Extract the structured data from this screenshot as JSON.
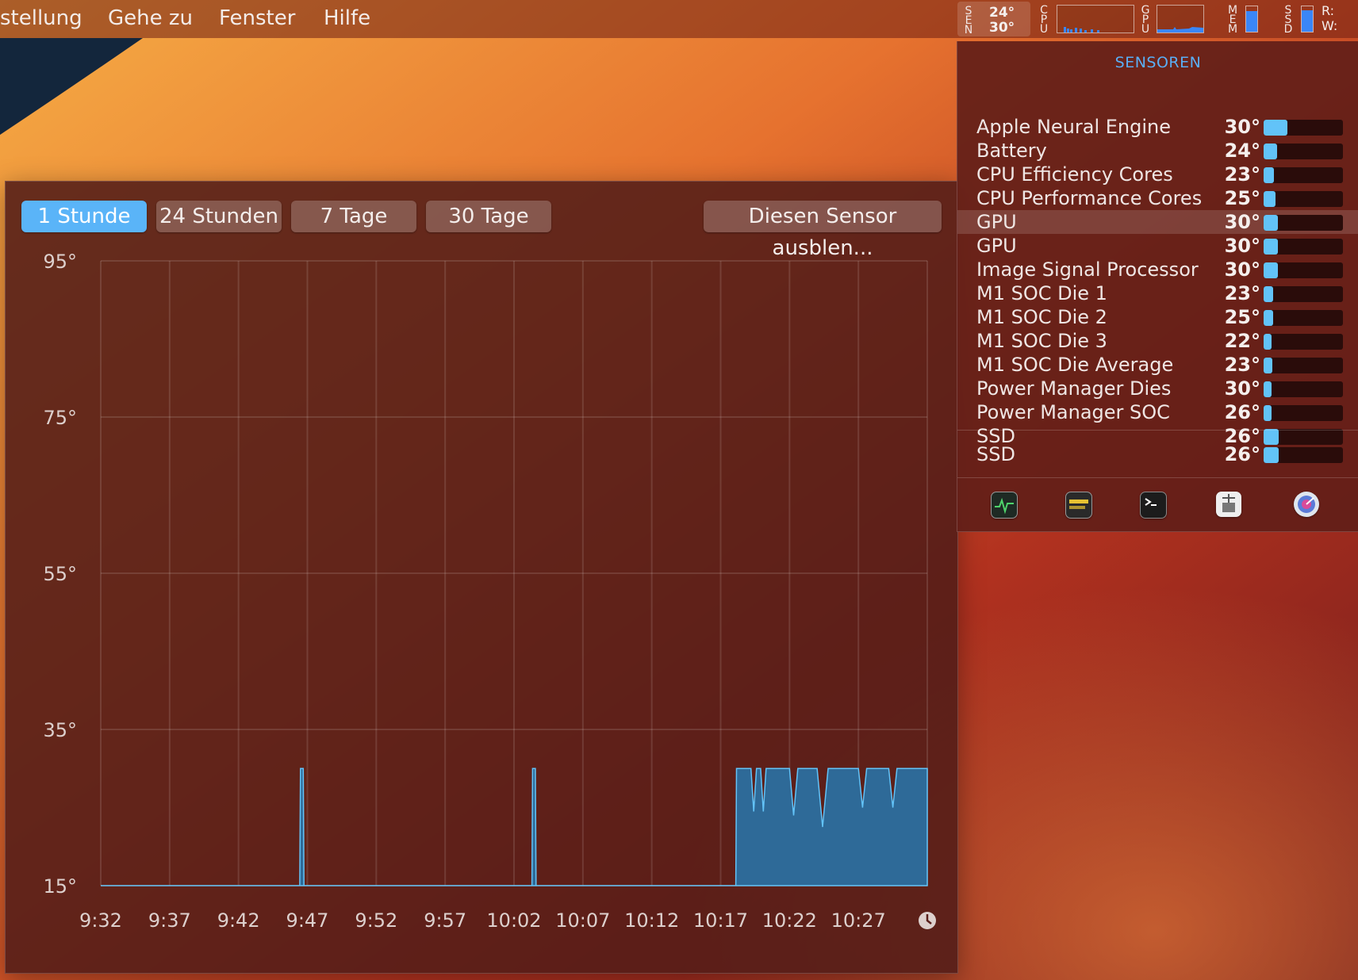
{
  "menubar": {
    "items": [
      "stellung",
      "Gehe zu",
      "Fenster",
      "Hilfe"
    ],
    "sen_label": "SEN",
    "sen_top": "24°",
    "sen_bottom": "30°",
    "cpu_label": "CPU",
    "gpu_label": "GPU",
    "mem_label": "MEM",
    "ssd_label": "SSD",
    "rw_read": "R:",
    "rw_write": "W:",
    "mem_level": 0.8,
    "ssd_level": 0.85
  },
  "history": {
    "tabs": [
      "1 Stunde",
      "24 Stunden",
      "7 Tage",
      "30 Tage"
    ],
    "active_tab": 0,
    "hide_button": "Diesen Sensor ausblen...",
    "clock_icon": "clock-icon"
  },
  "chart_data": {
    "type": "area",
    "x_ticks": [
      "9:32",
      "9:37",
      "9:42",
      "9:47",
      "9:52",
      "9:57",
      "10:02",
      "10:07",
      "10:12",
      "10:17",
      "10:22",
      "10:27"
    ],
    "y_ticks": [
      "95°",
      "75°",
      "55°",
      "35°",
      "15°"
    ],
    "ylim": [
      15,
      95
    ],
    "xlim_minutes": [
      0,
      60
    ],
    "grid": true,
    "color": "#2e6a98",
    "line_color": "#62c3f8",
    "series": [
      {
        "points": [
          [
            0,
            15
          ],
          [
            14.45,
            15
          ],
          [
            14.5,
            30
          ],
          [
            14.7,
            30
          ],
          [
            14.75,
            15
          ],
          [
            31.3,
            15
          ],
          [
            31.35,
            30
          ],
          [
            31.55,
            30
          ],
          [
            31.6,
            15
          ],
          [
            46.1,
            15
          ],
          [
            46.15,
            30
          ],
          [
            47.2,
            30
          ],
          [
            47.4,
            24.5
          ],
          [
            47.6,
            30
          ],
          [
            47.9,
            30
          ],
          [
            48.1,
            24.5
          ],
          [
            48.3,
            30
          ],
          [
            50.0,
            30
          ],
          [
            50.3,
            24
          ],
          [
            50.6,
            30
          ],
          [
            52.0,
            30
          ],
          [
            52.4,
            22.5
          ],
          [
            52.8,
            30
          ],
          [
            55.0,
            30
          ],
          [
            55.3,
            25
          ],
          [
            55.6,
            30
          ],
          [
            57.2,
            30
          ],
          [
            57.5,
            25
          ],
          [
            57.8,
            30
          ],
          [
            60,
            30
          ],
          [
            60,
            15
          ]
        ]
      }
    ]
  },
  "sensors": {
    "heading": "SENSOREN",
    "rows": [
      {
        "name": "Apple Neural Engine",
        "temp": "30°",
        "level": 0.3
      },
      {
        "name": "Battery",
        "temp": "24°",
        "level": 0.17
      },
      {
        "name": "CPU Efficiency Cores",
        "temp": "23°",
        "level": 0.13
      },
      {
        "name": "CPU Performance Cores",
        "temp": "25°",
        "level": 0.15
      },
      {
        "name": "GPU",
        "temp": "30°",
        "level": 0.18
      },
      {
        "name": "GPU",
        "temp": "30°",
        "level": 0.18
      },
      {
        "name": "Image Signal Processor",
        "temp": "30°",
        "level": 0.18
      },
      {
        "name": "M1 SOC Die 1",
        "temp": "23°",
        "level": 0.12
      },
      {
        "name": "M1 SOC Die 2",
        "temp": "25°",
        "level": 0.12
      },
      {
        "name": "M1 SOC Die 3",
        "temp": "22°",
        "level": 0.1
      },
      {
        "name": "M1 SOC Die Average",
        "temp": "23°",
        "level": 0.11
      },
      {
        "name": "Power Manager Dies",
        "temp": "30°",
        "level": 0.1
      },
      {
        "name": "Power Manager SOC",
        "temp": "26°",
        "level": 0.1
      },
      {
        "name": "SSD",
        "temp": "26°",
        "level": 0.19
      }
    ],
    "highlight_index": 4,
    "extra": {
      "name": "SSD",
      "temp": "26°",
      "level": 0.19
    },
    "apps": [
      "activity-monitor-icon",
      "console-icon",
      "terminal-icon",
      "system-information-icon",
      "disk-utility-icon"
    ]
  }
}
